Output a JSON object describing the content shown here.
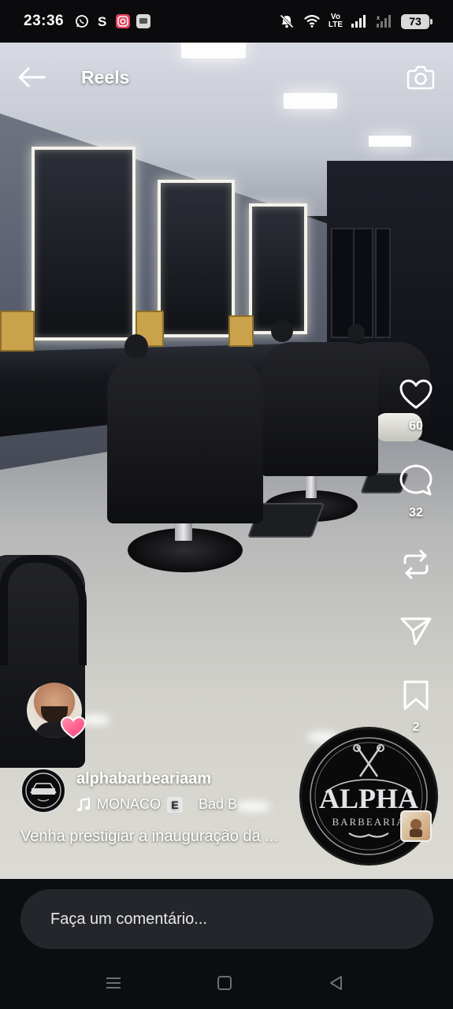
{
  "status": {
    "time": "23:36",
    "volte": [
      "Vo",
      "LTE"
    ],
    "battery": "73",
    "apps": [
      "whatsapp-icon",
      "skype-icon",
      "instagram-icon",
      "message-icon"
    ]
  },
  "header": {
    "title": "Reels",
    "back_icon": "arrow-left-icon",
    "camera_icon": "camera-icon"
  },
  "actions": {
    "likes": "60",
    "comments": "32",
    "saves": "2"
  },
  "post": {
    "username": "alphabarbeariaam",
    "music_title": "MONACO",
    "explicit_badge": "E",
    "music_artist": "Bad B",
    "caption": "Venha prestigiar a inauguração da ..."
  },
  "logo": {
    "brand": "ALPHA",
    "sub": "BARBEARIA"
  },
  "comment": {
    "placeholder": "Faça um comentário..."
  },
  "colors": {
    "heart_pink": "#ff5a8a",
    "bar_bg": "#0c0d10",
    "input_bg": "#24262b"
  }
}
